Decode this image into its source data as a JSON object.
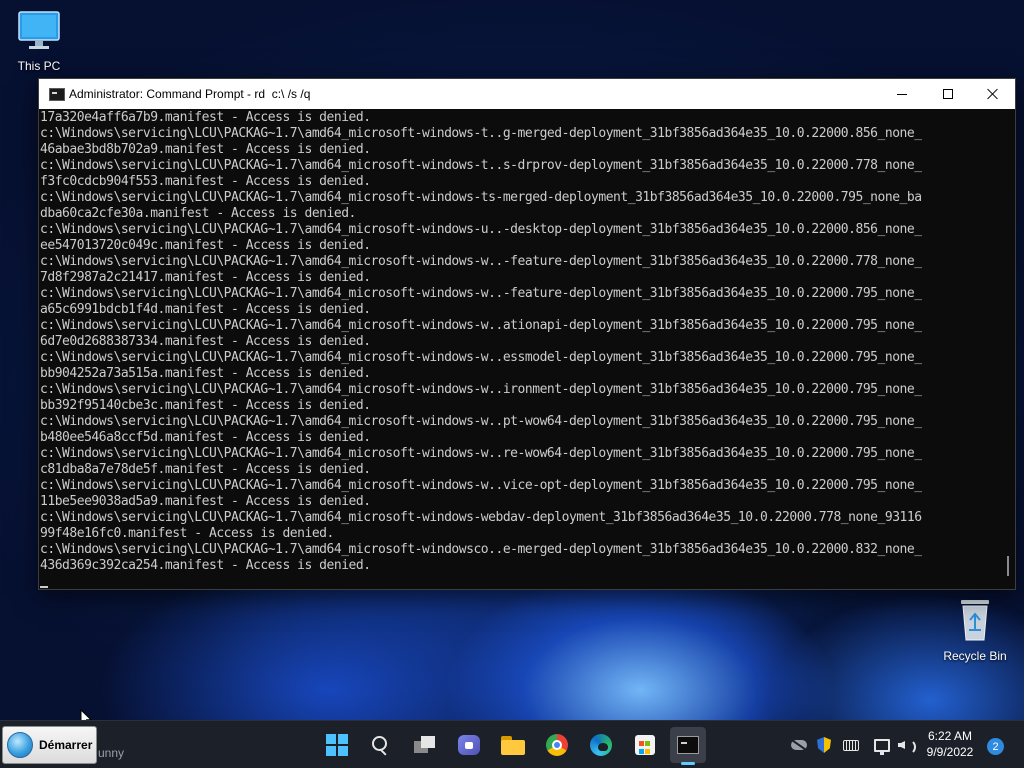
{
  "desktop": {
    "icons": [
      {
        "label": "This PC",
        "icon": "monitor-icon"
      },
      {
        "label": "Recycle Bin",
        "icon": "recycle-bin-icon"
      }
    ]
  },
  "window": {
    "title": "Administrator: Command Prompt - rd  c:\\ /s /q",
    "icon": "command-prompt-icon",
    "controls": {
      "minimize": "minimize-icon",
      "maximize": "maximize-icon",
      "close": "close-icon"
    },
    "console_lines": [
      "17a320e4aff6a7b9.manifest - Access is denied.",
      "c:\\Windows\\servicing\\LCU\\PACKAG~1.7\\amd64_microsoft-windows-t..g-merged-deployment_31bf3856ad364e35_10.0.22000.856_none_",
      "46abae3bd8b702a9.manifest - Access is denied.",
      "c:\\Windows\\servicing\\LCU\\PACKAG~1.7\\amd64_microsoft-windows-t..s-drprov-deployment_31bf3856ad364e35_10.0.22000.778_none_",
      "f3fc0cdcb904f553.manifest - Access is denied.",
      "c:\\Windows\\servicing\\LCU\\PACKAG~1.7\\amd64_microsoft-windows-ts-merged-deployment_31bf3856ad364e35_10.0.22000.795_none_ba",
      "dba60ca2cfe30a.manifest - Access is denied.",
      "c:\\Windows\\servicing\\LCU\\PACKAG~1.7\\amd64_microsoft-windows-u..-desktop-deployment_31bf3856ad364e35_10.0.22000.856_none_",
      "ee547013720c049c.manifest - Access is denied.",
      "c:\\Windows\\servicing\\LCU\\PACKAG~1.7\\amd64_microsoft-windows-w..-feature-deployment_31bf3856ad364e35_10.0.22000.778_none_",
      "7d8f2987a2c21417.manifest - Access is denied.",
      "c:\\Windows\\servicing\\LCU\\PACKAG~1.7\\amd64_microsoft-windows-w..-feature-deployment_31bf3856ad364e35_10.0.22000.795_none_",
      "a65c6991bdcb1f4d.manifest - Access is denied.",
      "c:\\Windows\\servicing\\LCU\\PACKAG~1.7\\amd64_microsoft-windows-w..ationapi-deployment_31bf3856ad364e35_10.0.22000.795_none_",
      "6d7e0d2688387334.manifest - Access is denied.",
      "c:\\Windows\\servicing\\LCU\\PACKAG~1.7\\amd64_microsoft-windows-w..essmodel-deployment_31bf3856ad364e35_10.0.22000.795_none_",
      "bb904252a73a515a.manifest - Access is denied.",
      "c:\\Windows\\servicing\\LCU\\PACKAG~1.7\\amd64_microsoft-windows-w..ironment-deployment_31bf3856ad364e35_10.0.22000.795_none_",
      "bb392f95140cbe3c.manifest - Access is denied.",
      "c:\\Windows\\servicing\\LCU\\PACKAG~1.7\\amd64_microsoft-windows-w..pt-wow64-deployment_31bf3856ad364e35_10.0.22000.795_none_",
      "b480ee546a8ccf5d.manifest - Access is denied.",
      "c:\\Windows\\servicing\\LCU\\PACKAG~1.7\\amd64_microsoft-windows-w..re-wow64-deployment_31bf3856ad364e35_10.0.22000.795_none_",
      "c81dba8a7e78de5f.manifest - Access is denied.",
      "c:\\Windows\\servicing\\LCU\\PACKAG~1.7\\amd64_microsoft-windows-w..vice-opt-deployment_31bf3856ad364e35_10.0.22000.795_none_",
      "11be5ee9038ad5a9.manifest - Access is denied.",
      "c:\\Windows\\servicing\\LCU\\PACKAG~1.7\\amd64_microsoft-windows-webdav-deployment_31bf3856ad364e35_10.0.22000.778_none_93116",
      "99f48e16fc0.manifest - Access is denied.",
      "c:\\Windows\\servicing\\LCU\\PACKAG~1.7\\amd64_microsoft-windowsco..e-merged-deployment_31bf3856ad364e35_10.0.22000.832_none_",
      "436d369c392ca254.manifest - Access is denied."
    ]
  },
  "taskbar": {
    "start_label": "Démarrer",
    "stray_text": "unny",
    "pinned": [
      {
        "name": "start-menu",
        "icon": "windows-logo-icon"
      },
      {
        "name": "search",
        "icon": "search-icon"
      },
      {
        "name": "task-view",
        "icon": "task-view-icon"
      },
      {
        "name": "chat",
        "icon": "chat-icon"
      },
      {
        "name": "file-explorer",
        "icon": "folder-icon"
      },
      {
        "name": "chrome",
        "icon": "chrome-icon"
      },
      {
        "name": "edge",
        "icon": "edge-icon"
      },
      {
        "name": "store",
        "icon": "store-icon"
      },
      {
        "name": "command-prompt",
        "icon": "terminal-icon",
        "active": true
      }
    ],
    "tray": {
      "icons": [
        "onedrive-icon",
        "security-shield-icon",
        "keyboard-icon",
        "network-icon",
        "volume-icon"
      ],
      "time": "6:22 AM",
      "date": "9/9/2022",
      "notification_count": "2"
    }
  },
  "colors": {
    "console_bg": "#0c0c0c",
    "console_text": "#cccccc",
    "taskbar_bg": "#1c2029",
    "accent": "#60cdff"
  }
}
